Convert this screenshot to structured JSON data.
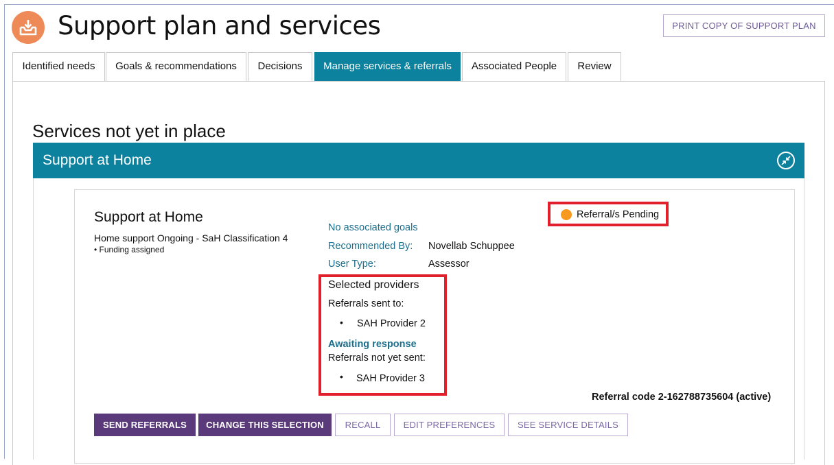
{
  "page": {
    "title": "Support plan and services",
    "print_button": "PRINT COPY OF SUPPORT PLAN",
    "logo_icon": "download-tray-icon",
    "accent_color": "#0c829e",
    "brand_color": "#ee8a58"
  },
  "tabs": [
    {
      "label": "Identified needs",
      "active": false
    },
    {
      "label": "Goals & recommendations",
      "active": false
    },
    {
      "label": "Decisions",
      "active": false
    },
    {
      "label": "Manage services & referrals",
      "active": true
    },
    {
      "label": "Associated People",
      "active": false
    },
    {
      "label": "Review",
      "active": false
    }
  ],
  "section": {
    "heading": "Services not yet in place",
    "banner_title": "Support at Home",
    "collapse_icon": "collapse-arrows-icon"
  },
  "service": {
    "title": "Support at Home",
    "description": "Home support Ongoing - SaH Classification 4",
    "funding": "• Funding assigned",
    "goals": "No associated goals",
    "recommended_by_label": "Recommended By:",
    "recommended_by_value": "Novellab Schuppee",
    "user_type_label": "User Type:",
    "user_type_value": "Assessor",
    "status": "Referral/s Pending",
    "status_color": "#f6991e",
    "providers": {
      "heading": "Selected providers",
      "sent_label": "Referrals sent to:",
      "sent": [
        "SAH Provider 2"
      ],
      "awaiting": "Awaiting response",
      "not_sent_label": "Referrals not yet sent:",
      "not_sent": [
        "SAH Provider 3"
      ]
    },
    "referral_code": "Referral code 2-162788735604 (active)"
  },
  "actions": {
    "send": "SEND REFERRALS",
    "change": "CHANGE THIS SELECTION",
    "recall": "RECALL",
    "edit": "EDIT PREFERENCES",
    "details": "SEE SERVICE DETAILS"
  }
}
